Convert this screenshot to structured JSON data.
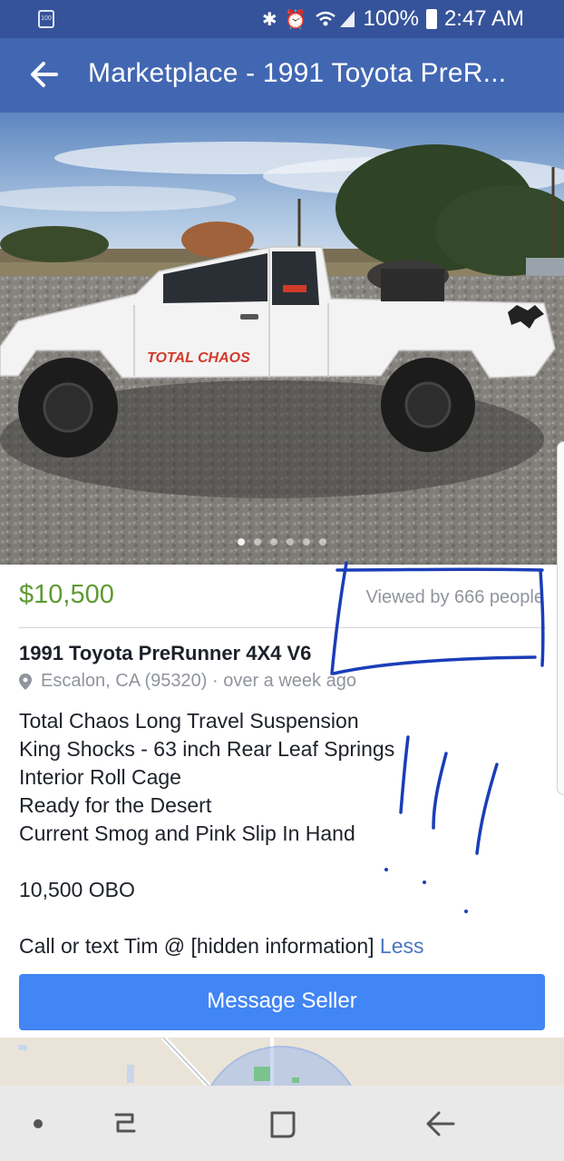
{
  "status_bar": {
    "left_badge": "100",
    "battery_percent": "100%",
    "time": "2:47 AM"
  },
  "app_bar": {
    "title": "Marketplace - 1991 Toyota PreR..."
  },
  "photo": {
    "decal_text": "TOTAL CHAOS",
    "carousel_count": 6,
    "carousel_active": 0
  },
  "listing": {
    "price": "$10,500",
    "viewed": "Viewed by 666 people",
    "title": "1991 Toyota PreRunner 4X4 V6",
    "location": "Escalon, CA (95320) · over a week ago",
    "description_lines": [
      "Total Chaos Long Travel Suspension",
      "King Shocks - 63 inch Rear Leaf Springs",
      "Interior Roll Cage",
      "Ready for the Desert",
      "Current Smog and Pink Slip In Hand",
      "",
      "10,500 OBO",
      "",
      "Call or text Tim @ [hidden information]"
    ],
    "less_link": "Less",
    "message_button": "Message Seller"
  },
  "colors": {
    "status_bar": "#35539a",
    "app_bar": "#4267b2",
    "price": "#5f9a32",
    "button": "#4285f4",
    "annotation_ink": "#1a3db8"
  }
}
